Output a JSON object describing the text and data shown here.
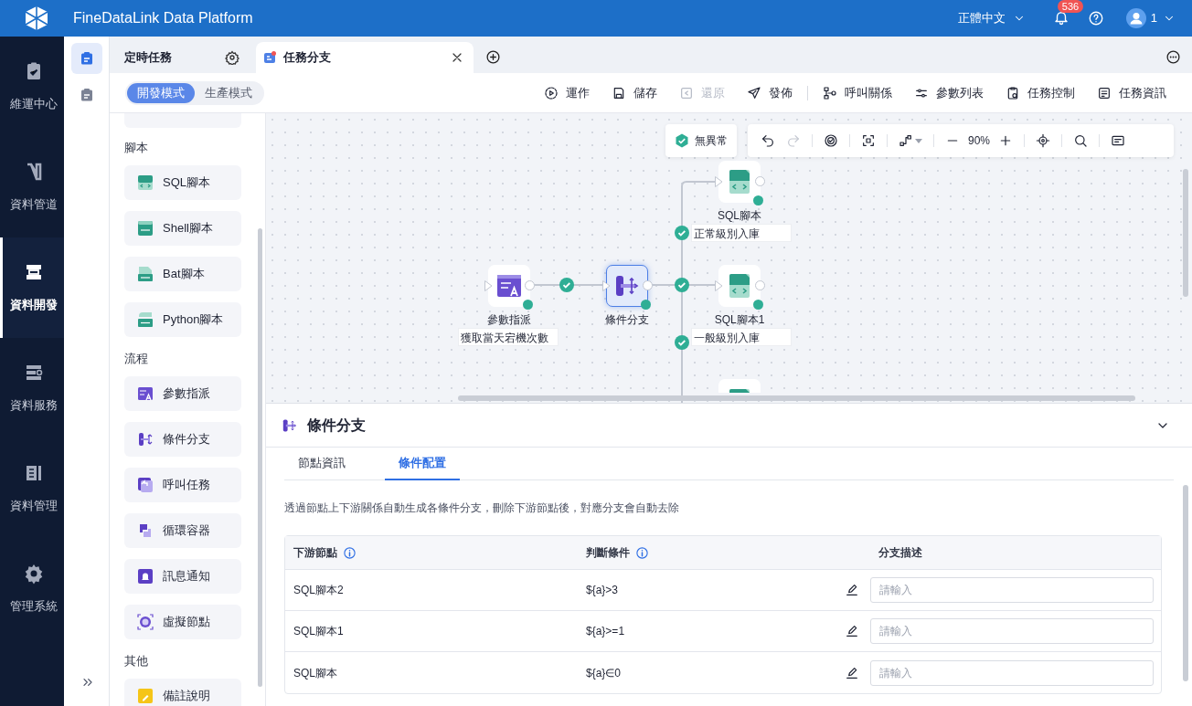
{
  "header": {
    "title": "FineDataLink Data Platform",
    "language": "正體中文",
    "notification_count": "536",
    "user": "1"
  },
  "nav": [
    {
      "label": "維運中心",
      "selected": false
    },
    {
      "label": "資料管道",
      "selected": false
    },
    {
      "label": "資料開發",
      "selected": true
    },
    {
      "label": "資料服務",
      "selected": false
    },
    {
      "label": "資料管理",
      "selected": false
    },
    {
      "label": "管理系統",
      "selected": false
    }
  ],
  "side_icons": [
    {
      "selected": true
    },
    {
      "selected": false
    }
  ],
  "tabs": [
    {
      "label": "定時任務",
      "selected": false
    },
    {
      "label": "任務分支",
      "selected": true
    }
  ],
  "modes": [
    {
      "label": "開發模式",
      "selected": true
    },
    {
      "label": "生產模式",
      "selected": false
    }
  ],
  "toolbar": [
    {
      "label": "運作",
      "disabled": false
    },
    {
      "label": "儲存",
      "disabled": false
    },
    {
      "label": "還原",
      "disabled": true
    },
    {
      "label": "發佈",
      "disabled": false
    },
    {
      "label": "呼叫關係",
      "disabled": false
    },
    {
      "label": "參數列表",
      "disabled": false
    },
    {
      "label": "任務控制",
      "disabled": false
    },
    {
      "label": "任務資訊",
      "disabled": false
    }
  ],
  "palette": [
    {
      "title": "腳本",
      "items": [
        {
          "kind": "sql",
          "label": "SQL腳本"
        },
        {
          "kind": "shell",
          "label": "Shell腳本"
        },
        {
          "kind": "bat",
          "label": "Bat腳本"
        },
        {
          "kind": "python",
          "label": "Python腳本"
        }
      ]
    },
    {
      "title": "流程",
      "items": [
        {
          "kind": "assign",
          "label": "參數指派"
        },
        {
          "kind": "branch",
          "label": "條件分支"
        },
        {
          "kind": "call",
          "label": "呼叫任務"
        },
        {
          "kind": "loop",
          "label": "循環容器"
        },
        {
          "kind": "notify",
          "label": "訊息通知"
        },
        {
          "kind": "virtual",
          "label": "虛擬節點"
        }
      ]
    },
    {
      "title": "其他",
      "items": [
        {
          "kind": "note",
          "label": "備註說明"
        }
      ]
    }
  ],
  "canvas": {
    "status": "無異常",
    "zoom": "90%",
    "nodes": [
      {
        "kind": "assign",
        "label": "參數指派",
        "description": "獲取當天宕機次數",
        "selected": false
      },
      {
        "kind": "branch",
        "label": "條件分支",
        "selected": true
      },
      {
        "kind": "sql",
        "label": "SQL腳本",
        "description": "正常級別入庫",
        "selected": false
      },
      {
        "kind": "sql",
        "label": "SQL腳本1",
        "description": "一般級別入庫",
        "selected": false
      },
      {
        "kind": "sql",
        "selected": false
      }
    ]
  },
  "detail": {
    "title": "條件分支",
    "tabs": [
      {
        "label": "節點資訊",
        "selected": false
      },
      {
        "label": "條件配置",
        "selected": true
      }
    ],
    "hint": "透過節點上下游關係自動生成各條件分支，刪除下游節點後，對應分支會自動去除",
    "table": {
      "columns": [
        "下游節點",
        "判斷條件",
        "分支描述"
      ],
      "rows": [
        {
          "node": "SQL腳本2",
          "condition": "${a}>3",
          "placeholder": "請輸入"
        },
        {
          "node": "SQL腳本1",
          "condition": "${a}>=1",
          "placeholder": "請輸入"
        },
        {
          "node": "SQL腳本",
          "condition": "${a}∈0",
          "placeholder": "請輸入"
        }
      ]
    }
  }
}
